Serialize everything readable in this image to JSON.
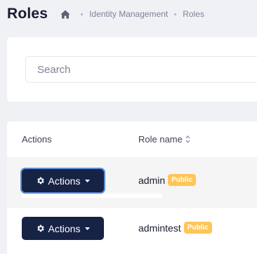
{
  "header": {
    "title": "Roles",
    "breadcrumb": [
      "Identity Management",
      "Roles"
    ]
  },
  "search": {
    "placeholder": "Search",
    "value": ""
  },
  "table": {
    "columns": [
      "Actions",
      "Role name"
    ],
    "rows": [
      {
        "action_label": "Actions",
        "role_name": "admin",
        "badge": "Public"
      },
      {
        "action_label": "Actions",
        "role_name": "admintest",
        "badge": "Public"
      }
    ]
  },
  "icons": {
    "home": "home-icon",
    "gear": "gear-icon",
    "caret": "caret-down-icon",
    "sort": "sort-icon"
  },
  "colors": {
    "accent": "#172345",
    "badge": "#ffc557",
    "background": "#f0f1f5"
  }
}
